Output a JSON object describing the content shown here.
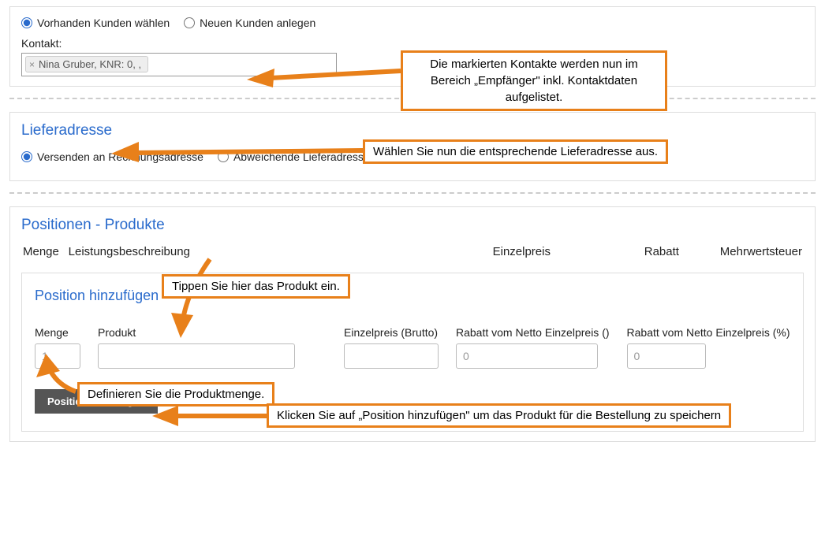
{
  "customer": {
    "option_existing": "Vorhanden Kunden wählen",
    "option_new": "Neuen Kunden anlegen",
    "contact_label": "Kontakt:",
    "selected_contact": "Nina Gruber, KNR: 0, ,"
  },
  "delivery": {
    "title": "Lieferadresse",
    "option_billing": "Versenden an Rechnungsadresse",
    "option_other": "Abweichende Lieferadresse"
  },
  "positions": {
    "title": "Positionen - Produkte",
    "col_qty": "Menge",
    "col_desc": "Leistungsbeschreibung",
    "col_unitprice": "Einzelpreis",
    "col_rabatt": "Rabatt",
    "col_vat": "Mehrwertsteuer"
  },
  "add_position": {
    "title": "Position hinzufügen",
    "label_qty": "Menge",
    "label_product": "Produkt",
    "label_unitprice": "Einzelpreis (Brutto)",
    "label_rabatt_abs": "Rabatt vom Netto Einzelpreis ()",
    "label_rabatt_pct": "Rabatt vom Netto Einzelpreis (%)",
    "qty_value": "1",
    "rabatt_abs_value": "0",
    "rabatt_pct_value": "0",
    "button": "Position hinzufügen"
  },
  "annotations": {
    "a1": "Die markierten Kontakte werden nun im Bereich „Empfänger\" inkl. Kontaktdaten aufgelistet.",
    "a2": "Wählen Sie nun die entsprechende Lieferadresse aus.",
    "a3": "Tippen Sie hier das Produkt ein.",
    "a4": "Definieren Sie die Produktmenge.",
    "a5": "Klicken Sie auf „Position hinzufügen\" um das Produkt für die Bestellung zu speichern"
  }
}
